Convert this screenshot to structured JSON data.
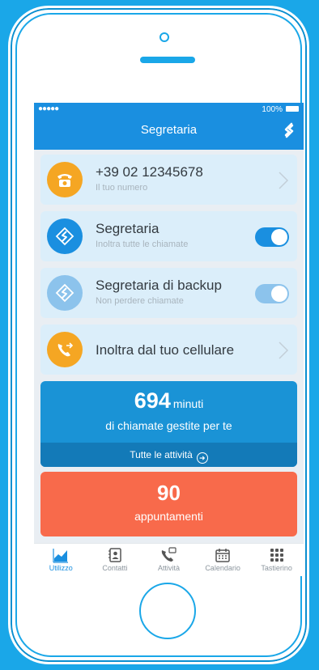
{
  "status": {
    "signal": "●●●●● ",
    "battery": "100%"
  },
  "header": {
    "title": "Segretaria"
  },
  "items": [
    {
      "title": "+39 02 12345678",
      "subtitle": "Il tuo numero",
      "icon": "phone-icon",
      "color": "#f5a623",
      "control": "chevron"
    },
    {
      "title": "Segretaria",
      "subtitle": "Inoltra tutte le chiamate",
      "icon": "segretaria-logo-icon",
      "color": "#1a8fe0",
      "control": "toggle-on"
    },
    {
      "title": "Segretaria di backup",
      "subtitle": "Non perdere chiamate",
      "icon": "segretaria-logo-icon",
      "color": "#8cc3ec",
      "control": "toggle-on"
    },
    {
      "title": "Inoltra dal tuo cellulare",
      "subtitle": "",
      "icon": "forward-call-icon",
      "color": "#f5a623",
      "control": "chevron"
    }
  ],
  "stats": {
    "number": "694",
    "unit": "minuti",
    "description": "di chiamate gestite per te",
    "link": "Tutte le attività"
  },
  "appointments": {
    "number": "90",
    "label": "appuntamenti"
  },
  "tabs": [
    {
      "label": "Utilizzo",
      "icon": "chart-icon",
      "active": true
    },
    {
      "label": "Contatti",
      "icon": "contacts-icon",
      "active": false
    },
    {
      "label": "Attività",
      "icon": "call-activity-icon",
      "active": false
    },
    {
      "label": "Calendario",
      "icon": "calendar-icon",
      "active": false
    },
    {
      "label": "Tastierino",
      "icon": "keypad-icon",
      "active": false
    }
  ],
  "colors": {
    "primary": "#1a8fe0",
    "orange": "#f5a623",
    "coral": "#f86a4b",
    "background": "#1aa7e8"
  }
}
